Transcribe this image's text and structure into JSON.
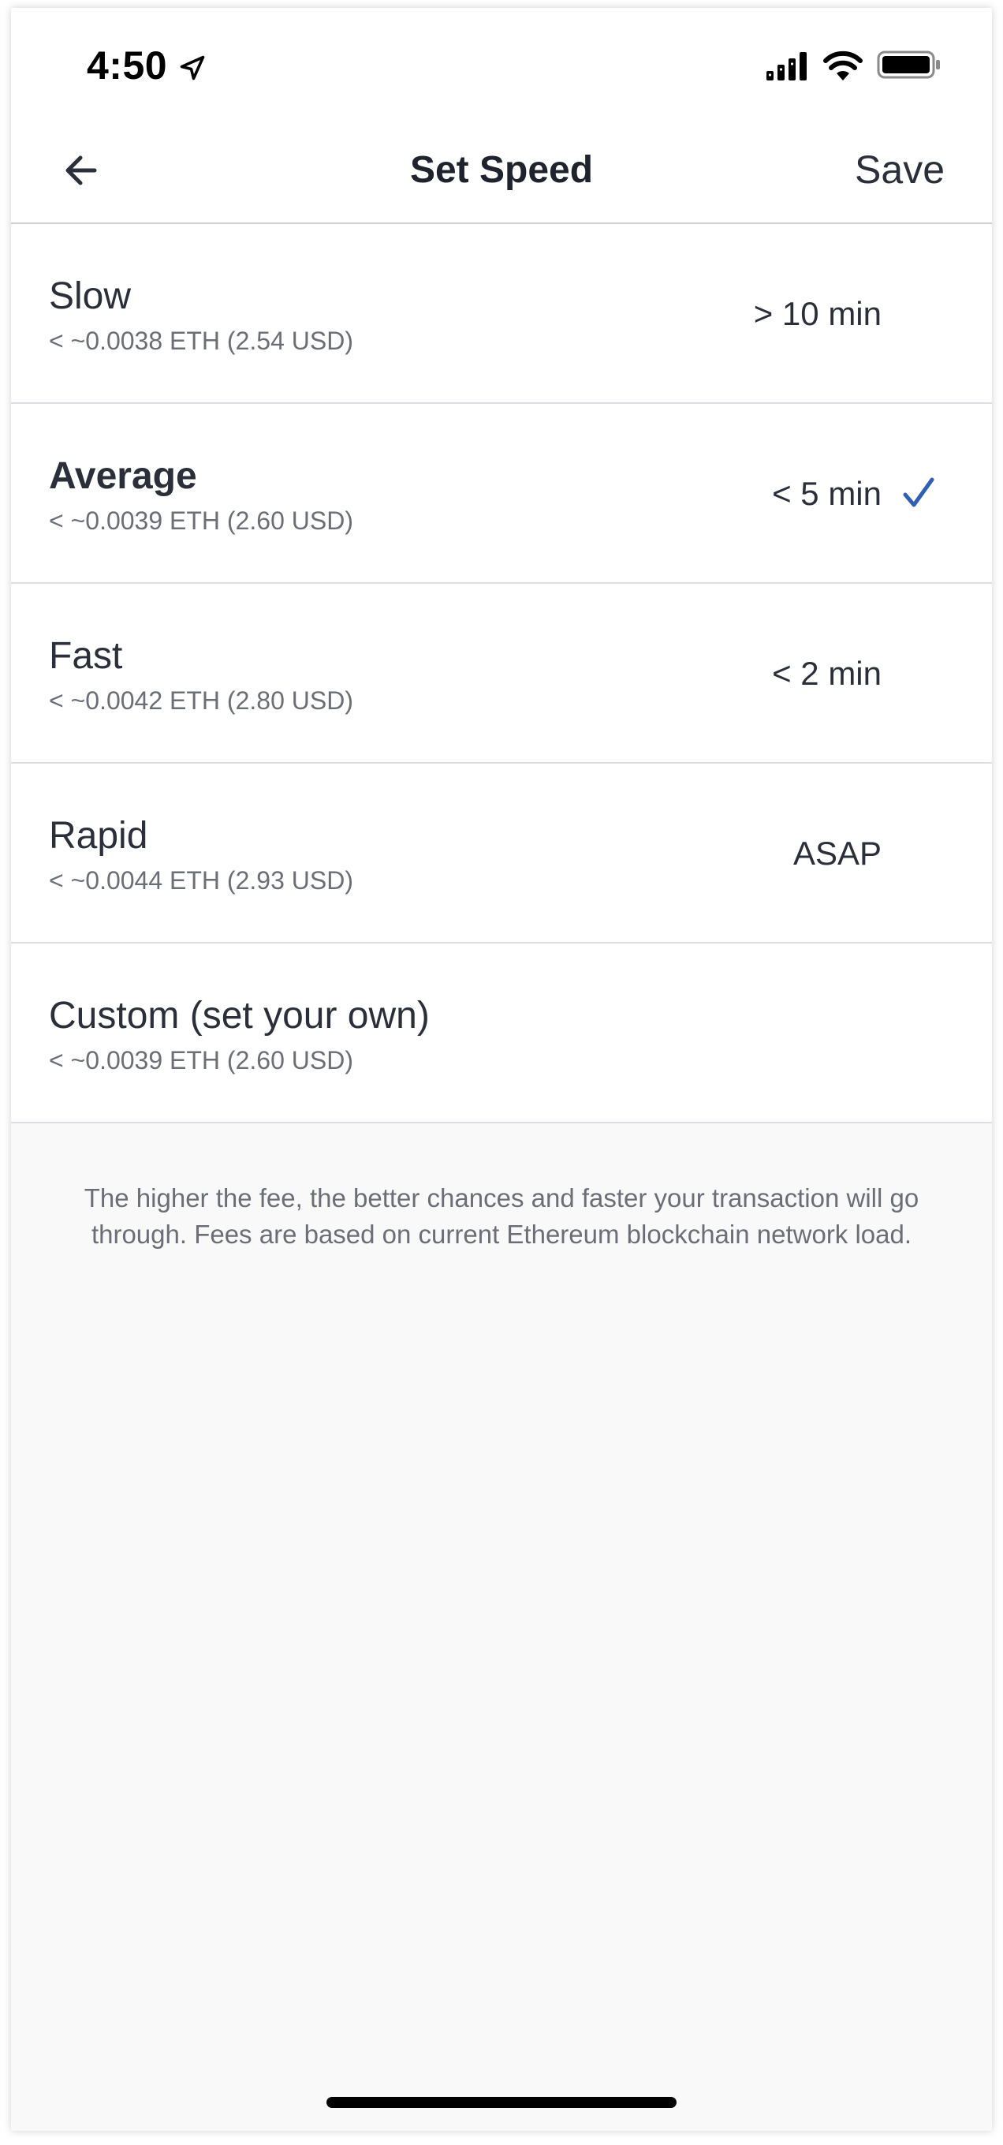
{
  "status_bar": {
    "time": "4:50"
  },
  "nav": {
    "title": "Set Speed",
    "save_label": "Save"
  },
  "speeds": [
    {
      "title": "Slow",
      "fee": "< ~0.0038 ETH (2.54 USD)",
      "time": "> 10 min",
      "selected": false
    },
    {
      "title": "Average",
      "fee": "< ~0.0039 ETH (2.60 USD)",
      "time": "< 5 min",
      "selected": true
    },
    {
      "title": "Fast",
      "fee": "< ~0.0042 ETH (2.80 USD)",
      "time": "< 2 min",
      "selected": false
    },
    {
      "title": "Rapid",
      "fee": "< ~0.0044 ETH (2.93 USD)",
      "time": "ASAP",
      "selected": false
    },
    {
      "title": "Custom (set your own)",
      "fee": "< ~0.0039 ETH (2.60 USD)",
      "time": "",
      "selected": false
    }
  ],
  "info": "The higher the fee, the better chances and faster your transaction will go through. Fees are based on current Ethereum blockchain network load.",
  "colors": {
    "accent": "#2f5fb3",
    "background": "#f9f9f9",
    "text": "#2b2f3a",
    "muted": "#6b6e76"
  }
}
